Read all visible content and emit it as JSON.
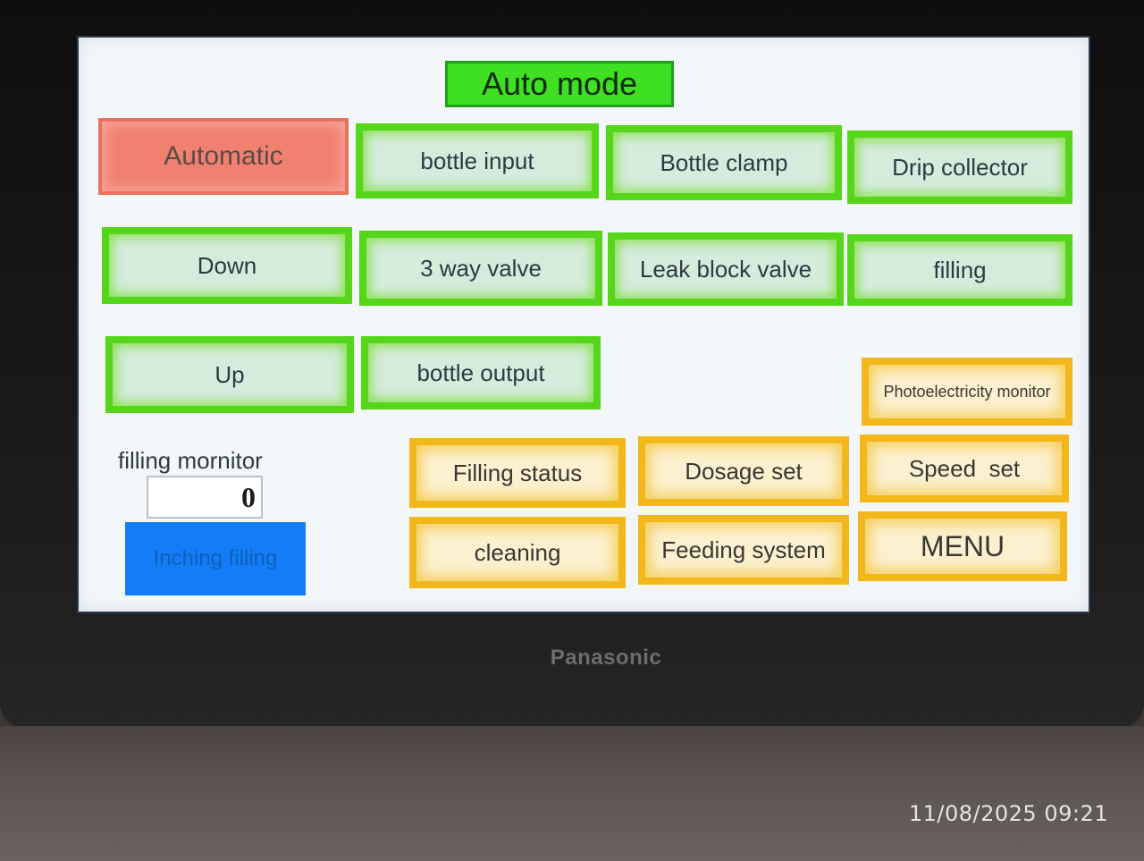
{
  "device": {
    "brand": "Panasonic"
  },
  "timestamp": "11/08/2025 09:21",
  "screen": {
    "title": "Auto mode",
    "buttons": {
      "automatic": "Automatic",
      "bottle_input": "bottle input",
      "bottle_clamp": "Bottle clamp",
      "drip_collector": "Drip collector",
      "down": "Down",
      "three_way_valve": "3 way valve",
      "leak_block_valve": "Leak block valve",
      "filling": "filling",
      "up": "Up",
      "bottle_output": "bottle output",
      "photoelectricity_monitor": "Photoelectricity monitor",
      "filling_status": "Filling status",
      "dosage_set": "Dosage set",
      "speed_set": "Speed  set",
      "cleaning": "cleaning",
      "feeding_system": "Feeding system",
      "menu": "MENU",
      "inching_filling": "Inching filling"
    },
    "filling_monitor": {
      "label": "filling mornitor",
      "value": "0"
    }
  },
  "colors": {
    "title_bg": "#3ee021",
    "green_button": "#55d61a",
    "yellow_button": "#f2b71a",
    "red_button": "#f08070",
    "blue_button": "#127df6"
  }
}
